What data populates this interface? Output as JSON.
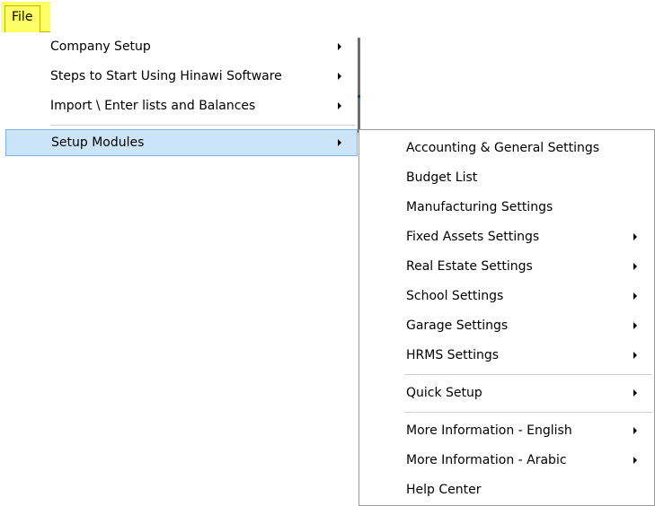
{
  "file_menu": {
    "label": "File"
  },
  "main_menu": {
    "items": [
      {
        "label": "Company Setup",
        "has_submenu": true
      },
      {
        "label": "Steps to Start Using Hinawi Software",
        "has_submenu": true
      },
      {
        "label": "Import \\ Enter lists and Balances",
        "has_submenu": true
      },
      {
        "label": "Setup Modules",
        "has_submenu": true,
        "highlighted": true
      }
    ]
  },
  "sub_menu": {
    "items": [
      {
        "label": "Accounting & General Settings",
        "has_submenu": false
      },
      {
        "label": "Budget List",
        "has_submenu": false
      },
      {
        "label": "Manufacturing Settings",
        "has_submenu": false
      },
      {
        "label": "Fixed Assets Settings",
        "has_submenu": true
      },
      {
        "label": "Real Estate Settings",
        "has_submenu": true
      },
      {
        "label": "School Settings",
        "has_submenu": true
      },
      {
        "label": "Garage Settings",
        "has_submenu": true
      },
      {
        "label": "HRMS Settings",
        "has_submenu": true
      },
      {
        "label": "Quick Setup",
        "has_submenu": true
      },
      {
        "label": "More Information - English",
        "has_submenu": true
      },
      {
        "label": "More Information - Arabic",
        "has_submenu": true
      },
      {
        "label": "Help Center",
        "has_submenu": false
      }
    ]
  },
  "colors": {
    "file_highlight": "#ffff66",
    "selection_fill": "#cce4f7",
    "selection_border": "#7ab4e8"
  }
}
